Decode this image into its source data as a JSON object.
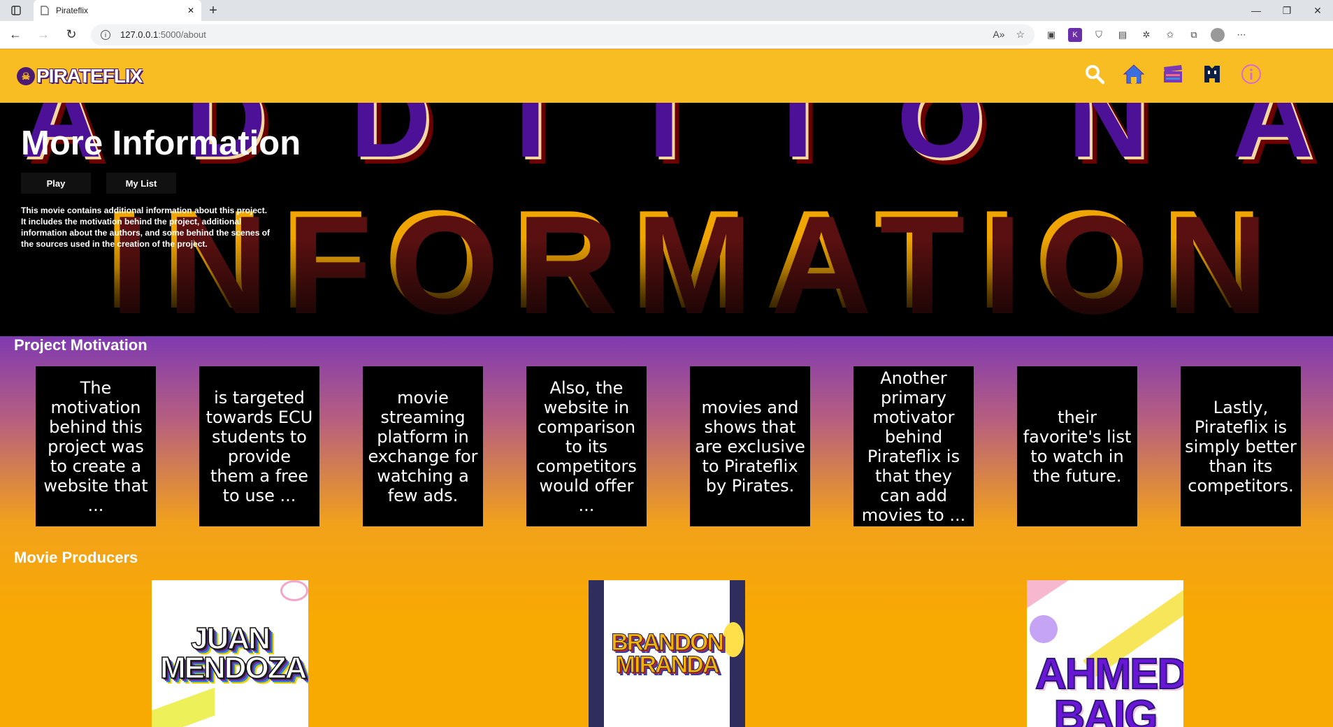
{
  "browser": {
    "tab_title": "Pirateflix",
    "url_host": "127.0.0.1",
    "url_path": ":5000/about",
    "new_tab": "+",
    "window_controls": [
      "—",
      "❐",
      "✕"
    ]
  },
  "site": {
    "logo_text": "PIRATEFLIX",
    "nav_icons": [
      "search-icon",
      "home-icon",
      "movies-icon",
      "github-icon",
      "info-icon"
    ],
    "brand_color": "#f9bd24",
    "accent_color": "#4b1a73"
  },
  "hero": {
    "bg_top_text": "ADDITIONAL",
    "bg_main_text": "INFORMATION",
    "title": "More Information",
    "play_label": "Play",
    "mylist_label": "My List",
    "description": "This movie contains additional information about this project. It includes the motivation behind the project, additional information about the authors, and some behind the scenes of the sources used in the creation of the project."
  },
  "motivation": {
    "title": "Project Motivation",
    "cards": [
      "The motivation behind this project was to create a website that ...",
      "is targeted towards ECU students to provide them a free to use ...",
      "movie streaming platform in exchange for watching a few ads.",
      "Also, the website in comparison to its competitors would offer ...",
      "movies and shows that are exclusive to Pirateflix by Pirates.",
      "Another primary motivator behind Pirateflix is that they can add movies to ...",
      "their favorite's list to watch in the future.",
      "Lastly, Pirateflix is simply better than its competitors."
    ]
  },
  "producers": {
    "title": "Movie Producers",
    "names": [
      "JUAN MENDOZA",
      "BRANDON MIRANDA",
      "AHMED BAIG"
    ]
  }
}
